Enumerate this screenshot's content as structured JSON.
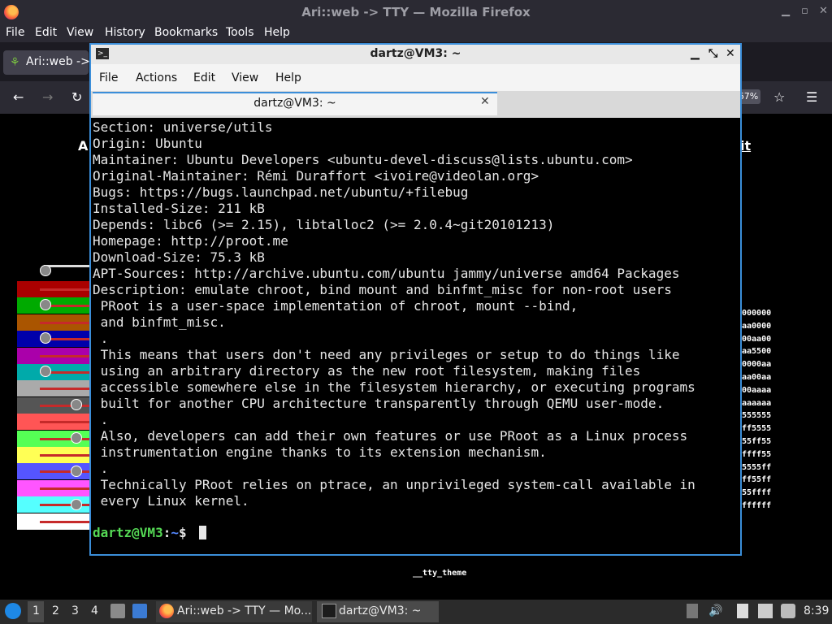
{
  "firefox": {
    "title": "Ari::web -> TTY — Mozilla Firefox",
    "menus": [
      "File",
      "Edit",
      "View",
      "History",
      "Bookmarks",
      "Tools",
      "Help"
    ],
    "menu_mnemonics": [
      "F",
      "E",
      "V",
      "s",
      "B",
      "T",
      "H"
    ],
    "tab_label": "Ari::web ->",
    "zoom": "67%"
  },
  "page": {
    "heading_left": "A",
    "heading_right": "it",
    "hex_labels": [
      "000000",
      "aa0000",
      "00aa00",
      "aa5500",
      "0000aa",
      "aa00aa",
      "00aaaa",
      "aaaaaa",
      "555555",
      "ff5555",
      "55ff55",
      "ffff55",
      "5555ff",
      "ff55ff",
      "55ffff",
      "ffffff"
    ],
    "footer_label": "__tty_theme",
    "swatch_colors": [
      "#000000",
      "#aa0000",
      "#00aa00",
      "#aa5500",
      "#0000aa",
      "#aa00aa",
      "#00aaaa",
      "#aaaaaa",
      "#555555",
      "#ff5555",
      "#55ff55",
      "#ffff55",
      "#5555ff",
      "#ff55ff",
      "#55ffff",
      "#ffffff"
    ]
  },
  "terminal": {
    "title": "dartz@VM3: ~",
    "menus": [
      "File",
      "Actions",
      "Edit",
      "View",
      "Help"
    ],
    "tab_label": "dartz@VM3: ~",
    "lines": [
      "Section: universe/utils",
      "Origin: Ubuntu",
      "Maintainer: Ubuntu Developers <ubuntu-devel-discuss@lists.ubuntu.com>",
      "Original-Maintainer: Rémi Duraffort <ivoire@videolan.org>",
      "Bugs: https://bugs.launchpad.net/ubuntu/+filebug",
      "Installed-Size: 211 kB",
      "Depends: libc6 (>= 2.15), libtalloc2 (>= 2.0.4~git20101213)",
      "Homepage: http://proot.me",
      "Download-Size: 75.3 kB",
      "APT-Sources: http://archive.ubuntu.com/ubuntu jammy/universe amd64 Packages",
      "Description: emulate chroot, bind mount and binfmt_misc for non-root users",
      " PRoot is a user-space implementation of chroot, mount --bind,",
      " and binfmt_misc.",
      " .",
      " This means that users don't need any privileges or setup to do things like",
      " using an arbitrary directory as the new root filesystem, making files",
      " accessible somewhere else in the filesystem hierarchy, or executing programs",
      " built for another CPU architecture transparently through QEMU user-mode.",
      " .",
      " Also, developers can add their own features or use PRoot as a Linux process",
      " instrumentation engine thanks to its extension mechanism.",
      " .",
      " Technically PRoot relies on ptrace, an unprivileged system-call available in",
      " every Linux kernel."
    ],
    "prompt_user": "dartz@VM3",
    "prompt_sep": ":",
    "prompt_path": "~",
    "prompt_sigil": "$ ",
    "colors": {
      "prompt_user": "#55d955",
      "prompt_path": "#5588ff",
      "text": "#e6e6e6",
      "accent": "#3b8ed9"
    }
  },
  "taskbar": {
    "workspaces": [
      "1",
      "2",
      "3",
      "4"
    ],
    "tasks": [
      {
        "label": "Ari::web -> TTY — Mo...",
        "icon": "firefox-icon"
      },
      {
        "label": "dartz@VM3: ~",
        "icon": "terminal-icon"
      }
    ],
    "clock": "8:39"
  }
}
